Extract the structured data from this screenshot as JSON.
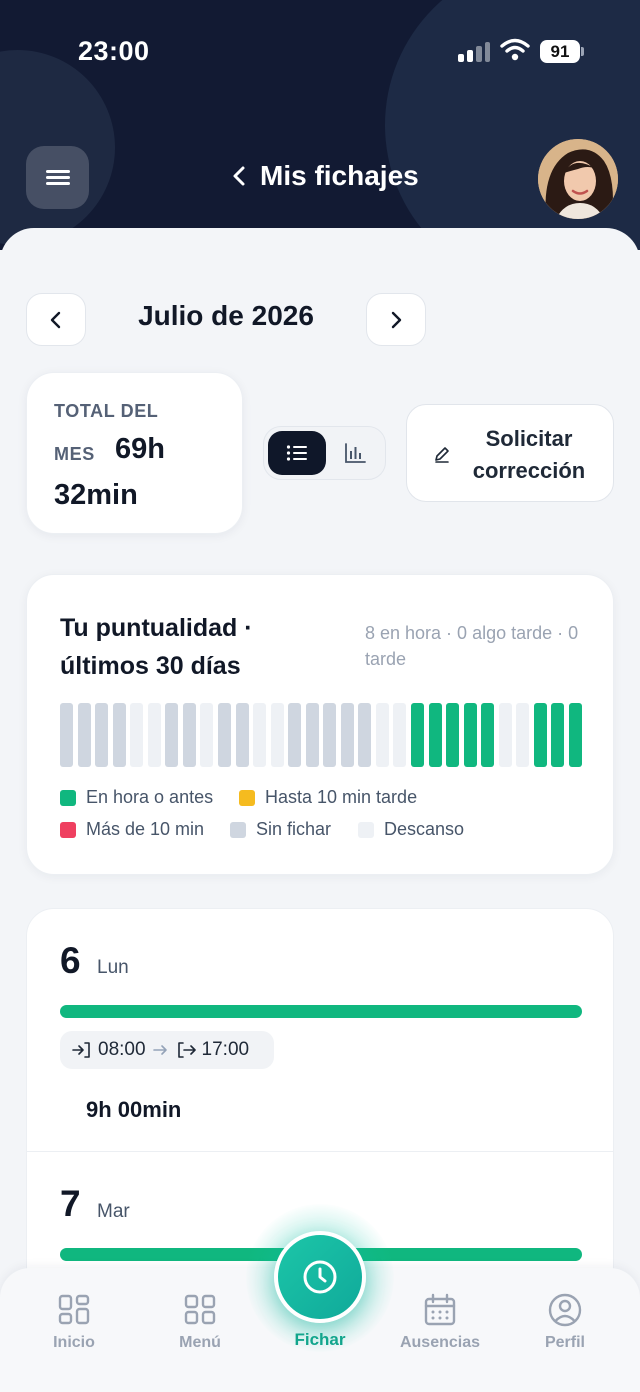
{
  "status_bar": {
    "time": "23:00",
    "battery": "91"
  },
  "header": {
    "title": "Mis fichajes"
  },
  "month_nav": {
    "label": "Julio de 2026"
  },
  "total": {
    "label_line1": "TOTAL DEL",
    "label_line2": "MES",
    "hours": "69h",
    "minutes": "32min"
  },
  "actions": {
    "correction_label": "Solicitar corrección"
  },
  "punctuality": {
    "title": "Tu puntualidad · últimos 30 días",
    "summary": "8 en hora · 0 algo tarde · 0 tarde",
    "days": [
      "sin-fichar",
      "sin-fichar",
      "sin-fichar",
      "sin-fichar",
      "descanso",
      "descanso",
      "sin-fichar",
      "sin-fichar",
      "descanso",
      "sin-fichar",
      "sin-fichar",
      "descanso",
      "descanso",
      "sin-fichar",
      "sin-fichar",
      "sin-fichar",
      "sin-fichar",
      "sin-fichar",
      "descanso",
      "descanso",
      "en-hora",
      "en-hora",
      "en-hora",
      "en-hora",
      "en-hora",
      "descanso",
      "descanso",
      "en-hora",
      "en-hora",
      "en-hora"
    ],
    "legend": {
      "on_time": "En hora o antes",
      "slightly_late": "Hasta 10 min tarde",
      "late": "Más de 10 min",
      "no_clock": "Sin fichar",
      "rest": "Descanso"
    },
    "colors": {
      "en-hora": "#10b77f",
      "algo-tarde": "#f5bb1f",
      "tarde": "#ef4060",
      "sin-fichar": "#cfd6e0",
      "descanso": "#eef1f5"
    }
  },
  "days": [
    {
      "num": "6",
      "weekday": "Lun",
      "in": "08:00",
      "out": "17:00",
      "total": "9h 00min"
    },
    {
      "num": "7",
      "weekday": "Mar"
    }
  ],
  "bottom_nav": {
    "home": "Inicio",
    "menu": "Menú",
    "clock": "Fichar",
    "absences": "Ausencias",
    "profile": "Perfil"
  }
}
